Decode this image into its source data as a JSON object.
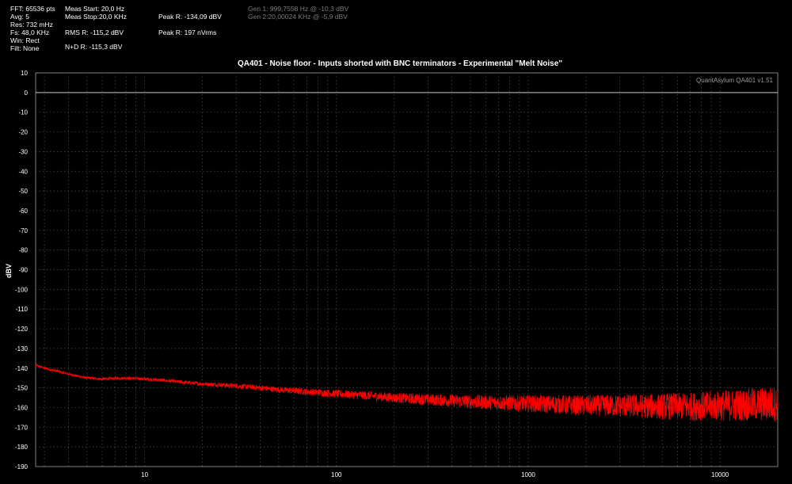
{
  "readouts": {
    "col1": [
      "FFT: 65536 pts",
      "Avg: 5",
      "Res: 732 mHz",
      "Fs: 48,0 KHz",
      "Win: Rect",
      "Filt: None"
    ],
    "meas_start": "Meas Start: 20,0 Hz",
    "meas_stop": "Meas Stop:20,0 KHz",
    "rms": "RMS R: -115,2 dBV",
    "nd": "N+D R: -115,3 dBV",
    "peak_dbv": "Peak R: -134,09 dBV",
    "peak_nv": "Peak R: 197 nVrms",
    "gen1": "Gen 1: 999,7558 Hz @ -10,3  dBV",
    "gen2": "Gen 2:20,00024 KHz @ -5,9  dBV"
  },
  "colors": {
    "background": "#000000",
    "trace": "#ff0000",
    "grid": "#505050",
    "reference_line": "#c8c8c8",
    "text": "#ffffff",
    "generator_text": "#7a7a7a"
  },
  "chart_data": {
    "type": "line",
    "title": "QA401 - Noise floor - Inputs shorted with BNC terminators - Experimental \"Melt Noise\"",
    "watermark": "QuantAsylum QA401 v1.51",
    "xlabel": "",
    "ylabel": "dBV",
    "x_scale": "log",
    "xlim": [
      2.7,
      20000
    ],
    "ylim": [
      -190,
      10
    ],
    "x_ticks": [
      10,
      100,
      1000,
      10000
    ],
    "x_tick_labels": [
      "10",
      "100",
      "1000",
      "10000"
    ],
    "y_ticks": [
      10,
      0,
      -10,
      -20,
      -30,
      -40,
      -50,
      -60,
      -70,
      -80,
      -90,
      -100,
      -110,
      -120,
      -130,
      -140,
      -150,
      -160,
      -170,
      -180,
      -190
    ],
    "y_tick_labels": [
      "10",
      "0",
      "-10",
      "-20",
      "-30",
      "-40",
      "-50",
      "-60",
      "-70",
      "-80",
      "-90",
      "-100",
      "-110",
      "-120",
      "-130",
      "-140",
      "-150",
      "-160",
      "-170",
      "-180",
      "-190"
    ],
    "grid": true,
    "reference_line_y": 0,
    "series": [
      {
        "name": "",
        "color": "#ff0000",
        "x": [
          2.7,
          3,
          3.5,
          4,
          5,
          6,
          8,
          10,
          12,
          15,
          20,
          25,
          30,
          40,
          50,
          70,
          100,
          150,
          200,
          300,
          500,
          700,
          1000,
          1500,
          2000,
          3000,
          5000,
          7000,
          10000,
          15000,
          20000
        ],
        "y": [
          -138.5,
          -140,
          -141.5,
          -143,
          -145,
          -145.5,
          -145,
          -145.5,
          -146,
          -147,
          -148,
          -148.5,
          -149,
          -150,
          -151,
          -152,
          -153,
          -154,
          -155,
          -156,
          -157,
          -157.5,
          -158,
          -158.5,
          -159,
          -159,
          -159.5,
          -159.5,
          -159,
          -158.5,
          -158
        ]
      }
    ]
  }
}
